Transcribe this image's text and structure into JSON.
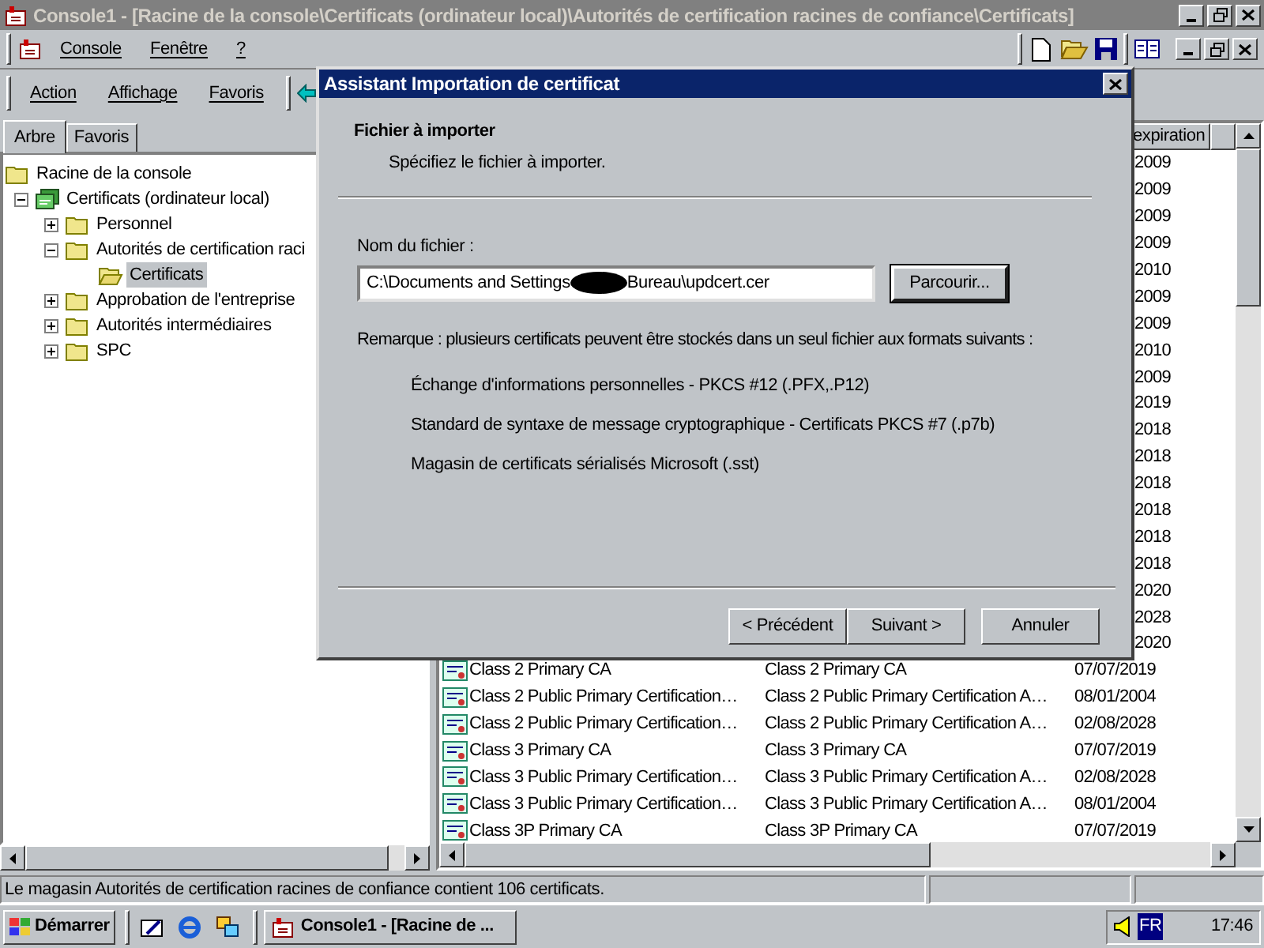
{
  "window": {
    "title": "Console1 - [Racine de la console\\Certificats (ordinateur local)\\Autorités de certification racines de confiance\\Certificats]",
    "active": false
  },
  "menu": [
    "Console",
    "Fenêtre",
    "?"
  ],
  "action_bar": [
    "Action",
    "Affichage",
    "Favoris"
  ],
  "left_tabs": [
    {
      "label": "Arbre",
      "selected": true
    },
    {
      "label": "Favoris",
      "selected": false
    }
  ],
  "tree": [
    {
      "label": "Racine de la console",
      "kind": "folder",
      "selected": false,
      "children": [
        {
          "label": "Certificats (ordinateur local)",
          "kind": "store",
          "expanded": true,
          "selected": false,
          "children": [
            {
              "label": "Personnel",
              "kind": "folder",
              "expanded": false,
              "selected": false
            },
            {
              "label": "Autorités de certification raci",
              "kind": "folder",
              "expanded": true,
              "selected": false,
              "children": [
                {
                  "label": "Certificats",
                  "kind": "open-folder",
                  "selected": true
                }
              ]
            },
            {
              "label": "Approbation de l'entreprise",
              "kind": "folder",
              "expanded": false,
              "selected": false
            },
            {
              "label": "Autorités intermédiaires",
              "kind": "folder",
              "expanded": false,
              "selected": false
            },
            {
              "label": "SPC",
              "kind": "folder",
              "expanded": false,
              "selected": false
            }
          ]
        }
      ]
    }
  ],
  "list": {
    "header": "expiration",
    "rows": [
      {
        "expiration": "2009"
      },
      {
        "expiration": "2009"
      },
      {
        "expiration": "2009"
      },
      {
        "expiration": "2009"
      },
      {
        "expiration": "2010"
      },
      {
        "expiration": "2009"
      },
      {
        "expiration": "2009"
      },
      {
        "expiration": "2010"
      },
      {
        "expiration": "2009"
      },
      {
        "expiration": "2019"
      },
      {
        "expiration": "2018"
      },
      {
        "expiration": "2018"
      },
      {
        "expiration": "2018"
      },
      {
        "expiration": "2018"
      },
      {
        "expiration": "2018"
      },
      {
        "expiration": "2018"
      },
      {
        "expiration": "2020"
      },
      {
        "expiration": "2028"
      },
      {
        "expiration": "2020"
      },
      {
        "name": "Class 2 Primary CA",
        "issued_by": "Class 2 Primary CA",
        "expiration": "07/07/2019"
      },
      {
        "name": "Class 2 Public Primary Certification…",
        "issued_by": "Class 2 Public Primary Certification A…",
        "expiration": "08/01/2004"
      },
      {
        "name": "Class 2 Public Primary Certification…",
        "issued_by": "Class 2 Public Primary Certification A…",
        "expiration": "02/08/2028"
      },
      {
        "name": "Class 3 Primary CA",
        "issued_by": "Class 3 Primary CA",
        "expiration": "07/07/2019"
      },
      {
        "name": "Class 3 Public Primary Certification…",
        "issued_by": "Class 3 Public Primary Certification A…",
        "expiration": "02/08/2028"
      },
      {
        "name": "Class 3 Public Primary Certification…",
        "issued_by": "Class 3 Public Primary Certification A…",
        "expiration": "08/01/2004"
      },
      {
        "name": "Class 3P Primary CA",
        "issued_by": "Class 3P Primary CA",
        "expiration": "07/07/2019"
      }
    ]
  },
  "status_bar": "Le magasin Autorités de certification racines de confiance contient 106 certificats.",
  "dialog": {
    "title": "Assistant Importation de certificat",
    "heading": "Fichier à importer",
    "subheading": "Spécifiez le fichier à importer.",
    "file_label": "Nom du fichier :",
    "file_value_start": "C:\\Documents and Settings",
    "file_value_end": "Bureau\\updcert.cer",
    "redacted": true,
    "browse_button": "Parcourir...",
    "note": "Remarque : plusieurs certificats peuvent être stockés dans un seul fichier aux formats suivants :",
    "formats": [
      "Échange d'informations personnelles - PKCS #12 (.PFX,.P12)",
      "Standard de syntaxe de message cryptographique - Certificats PKCS #7 (.p7b)",
      "Magasin de certificats sérialisés Microsoft (.sst)"
    ],
    "buttons": [
      {
        "label": "< Précédent",
        "kind": "back"
      },
      {
        "label": "Suivant >",
        "kind": "next"
      },
      {
        "label": "Annuler",
        "kind": "cancel"
      }
    ]
  },
  "taskbar": {
    "start": "Démarrer",
    "tasks": [
      {
        "label": "Console1 - [Racine de ...",
        "selected": false
      }
    ],
    "language": "FR",
    "clock": "17:46"
  }
}
